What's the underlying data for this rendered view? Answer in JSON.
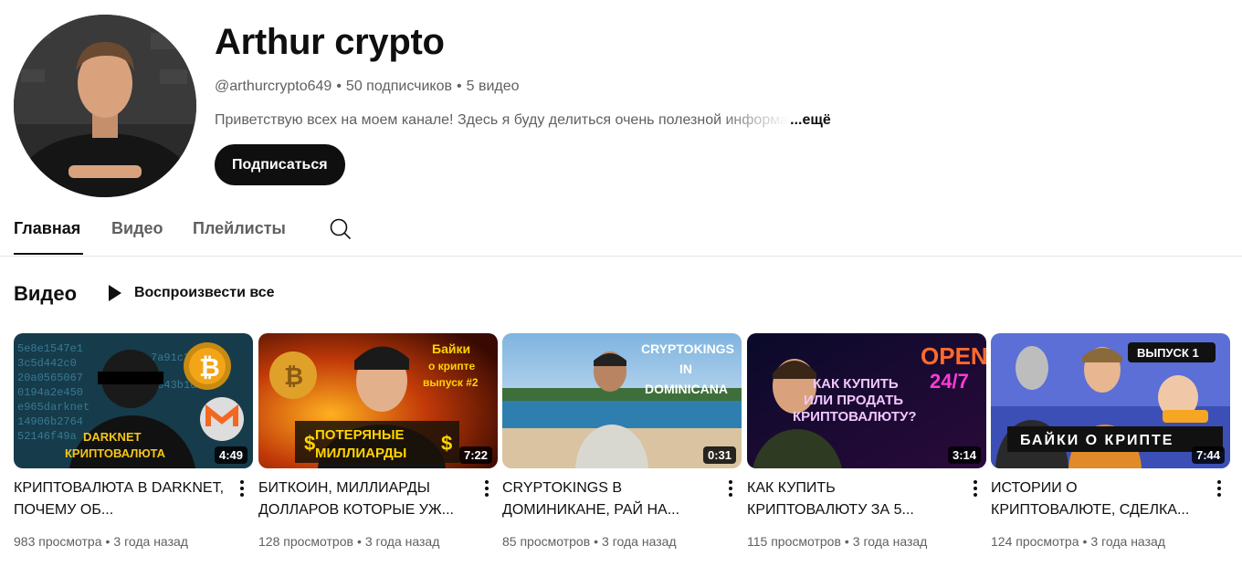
{
  "channel": {
    "name": "Arthur crypto",
    "handle": "@arthurcrypto649",
    "subscribers": "50 подписчиков",
    "video_count": "5 видео",
    "description": "Приветствую всех на моем канале! Здесь я буду делиться очень полезной информа",
    "more_label": "...ещё",
    "subscribe_label": "Подписаться"
  },
  "tabs": [
    {
      "label": "Главная",
      "active": true
    },
    {
      "label": "Видео",
      "active": false
    },
    {
      "label": "Плейлисты",
      "active": false
    }
  ],
  "icons": {
    "search": "search-icon",
    "play": "play-icon",
    "more": "more-vert-icon"
  },
  "section": {
    "title": "Видео",
    "play_all_label": "Воспроизвести все"
  },
  "videos": [
    {
      "title": "КРИПТОВАЛЮТА В DARKNET, ПОЧЕМУ ОБ...",
      "duration": "4:49",
      "views": "983 просмотра",
      "age": "3 года назад",
      "thumb_text": [
        "DARKNET",
        "КРИПТОВАЛЮТА"
      ]
    },
    {
      "title": "БИТКОИН, МИЛЛИАРДЫ ДОЛЛАРОВ КОТОРЫЕ УЖ...",
      "duration": "7:22",
      "views": "128 просмотров",
      "age": "3 года назад",
      "thumb_text": [
        "Байки",
        "о крипте",
        "выпуск #2",
        "ПОТЕРЯНЫЕ",
        "МИЛЛИАРДЫ"
      ]
    },
    {
      "title": "CRYPTOKINGS В ДОМИНИКАНЕ, РАЙ НА...",
      "duration": "0:31",
      "views": "85 просмотров",
      "age": "3 года назад",
      "thumb_text": [
        "CRYPTOKINGS",
        "IN",
        "DOMINICANA"
      ]
    },
    {
      "title": "КАК КУПИТЬ КРИПТОВАЛЮТУ ЗА 5...",
      "duration": "3:14",
      "views": "115 просмотров",
      "age": "3 года назад",
      "thumb_text": [
        "OPEN",
        "24/7",
        "КАК КУПИТЬ",
        "ИЛИ ПРОДАТЬ",
        "КРИПТОВАЛЮТУ?"
      ]
    },
    {
      "title": "ИСТОРИИ О КРИПТОВАЛЮТЕ, СДЕЛКА...",
      "duration": "7:44",
      "views": "124 просмотра",
      "age": "3 года назад",
      "thumb_text": [
        "ВЫПУСК 1",
        "БАЙКИ О КРИПТЕ"
      ]
    }
  ],
  "colors": {
    "primary_text": "#0f0f0f",
    "secondary_text": "#606060",
    "subscribe_bg": "#0f0f0f",
    "divider": "#e5e5e5"
  }
}
